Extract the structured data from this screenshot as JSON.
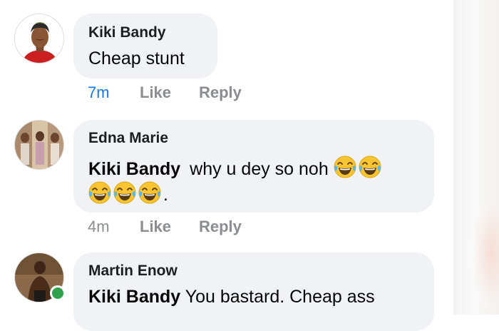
{
  "comments": [
    {
      "author": "Kiki Bandy",
      "text": "Cheap stunt",
      "time": "7m",
      "like_label": "Like",
      "reply_label": "Reply"
    },
    {
      "author": "Edna Marie",
      "mention": "Kiki Bandy",
      "text_line1": "why u dey so noh",
      "line2_suffix": ".",
      "time": "4m",
      "like_label": "Like",
      "reply_label": "Reply"
    },
    {
      "author": "Martin Enow",
      "mention": "Kiki Bandy",
      "text": "You bastard. Cheap ass"
    }
  ],
  "emoji_name": "tears-of-joy-emoji",
  "colors": {
    "bubble": "#f0f2f5",
    "recent_time": "#1877f2",
    "meta_text": "#8a8d91",
    "online": "#31a24c"
  }
}
